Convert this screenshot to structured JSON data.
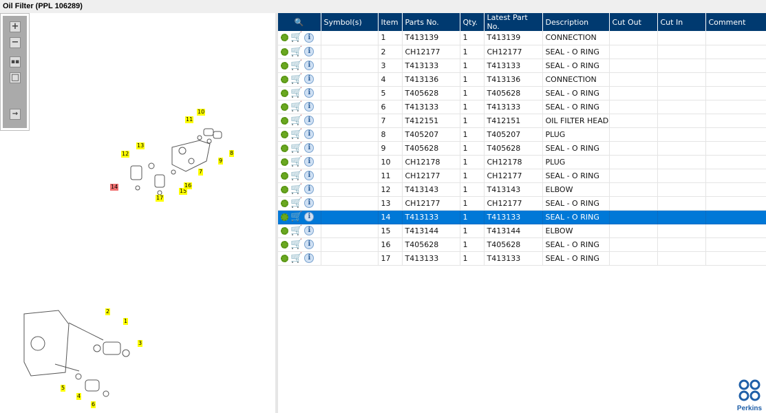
{
  "title": "Oil Filter (PPL 106289)",
  "columns": [
    "Symbol(s)",
    "Item",
    "Parts No.",
    "Qty.",
    "Latest Part No.",
    "Description",
    "Cut Out",
    "Cut In",
    "Comment"
  ],
  "rows": [
    [
      "",
      "1",
      "T413139",
      "1",
      "T413139",
      "CONNECTION",
      "",
      "",
      ""
    ],
    [
      "",
      "2",
      "CH12177",
      "1",
      "CH12177",
      "SEAL - O RING",
      "",
      "",
      ""
    ],
    [
      "",
      "3",
      "T413133",
      "1",
      "T413133",
      "SEAL - O RING",
      "",
      "",
      ""
    ],
    [
      "",
      "4",
      "T413136",
      "1",
      "T413136",
      "CONNECTION",
      "",
      "",
      ""
    ],
    [
      "",
      "5",
      "T405628",
      "1",
      "T405628",
      "SEAL - O RING",
      "",
      "",
      ""
    ],
    [
      "",
      "6",
      "T413133",
      "1",
      "T413133",
      "SEAL - O RING",
      "",
      "",
      ""
    ],
    [
      "",
      "7",
      "T412151",
      "1",
      "T412151",
      "OIL FILTER HEAD",
      "",
      "",
      ""
    ],
    [
      "",
      "8",
      "T405207",
      "1",
      "T405207",
      "PLUG",
      "",
      "",
      ""
    ],
    [
      "",
      "9",
      "T405628",
      "1",
      "T405628",
      "SEAL - O RING",
      "",
      "",
      ""
    ],
    [
      "",
      "10",
      "CH12178",
      "1",
      "CH12178",
      "PLUG",
      "",
      "",
      ""
    ],
    [
      "",
      "11",
      "CH12177",
      "1",
      "CH12177",
      "SEAL - O RING",
      "",
      "",
      ""
    ],
    [
      "",
      "12",
      "T413143",
      "1",
      "T413143",
      "ELBOW",
      "",
      "",
      ""
    ],
    [
      "",
      "13",
      "CH12177",
      "1",
      "CH12177",
      "SEAL - O RING",
      "",
      "",
      ""
    ],
    [
      "",
      "14",
      "T413133",
      "1",
      "T413133",
      "SEAL - O RING",
      "",
      "",
      ""
    ],
    [
      "",
      "15",
      "T413144",
      "1",
      "T413144",
      "ELBOW",
      "",
      "",
      ""
    ],
    [
      "",
      "16",
      "T405628",
      "1",
      "T405628",
      "SEAL - O RING",
      "",
      "",
      ""
    ],
    [
      "",
      "17",
      "T413133",
      "1",
      "T413133",
      "SEAL - O RING",
      "",
      "",
      ""
    ]
  ],
  "selected_item": "14",
  "callouts": [
    "10",
    "11",
    "8",
    "9",
    "7",
    "12",
    "13",
    "14",
    "15",
    "16",
    "17",
    "2",
    "1",
    "3",
    "5",
    "4",
    "6"
  ],
  "logo": "Perkins",
  "colors": {
    "header": "#003a70",
    "selected": "#0078d7",
    "callout": "#ffff00",
    "callout_selected": "#f07070"
  }
}
